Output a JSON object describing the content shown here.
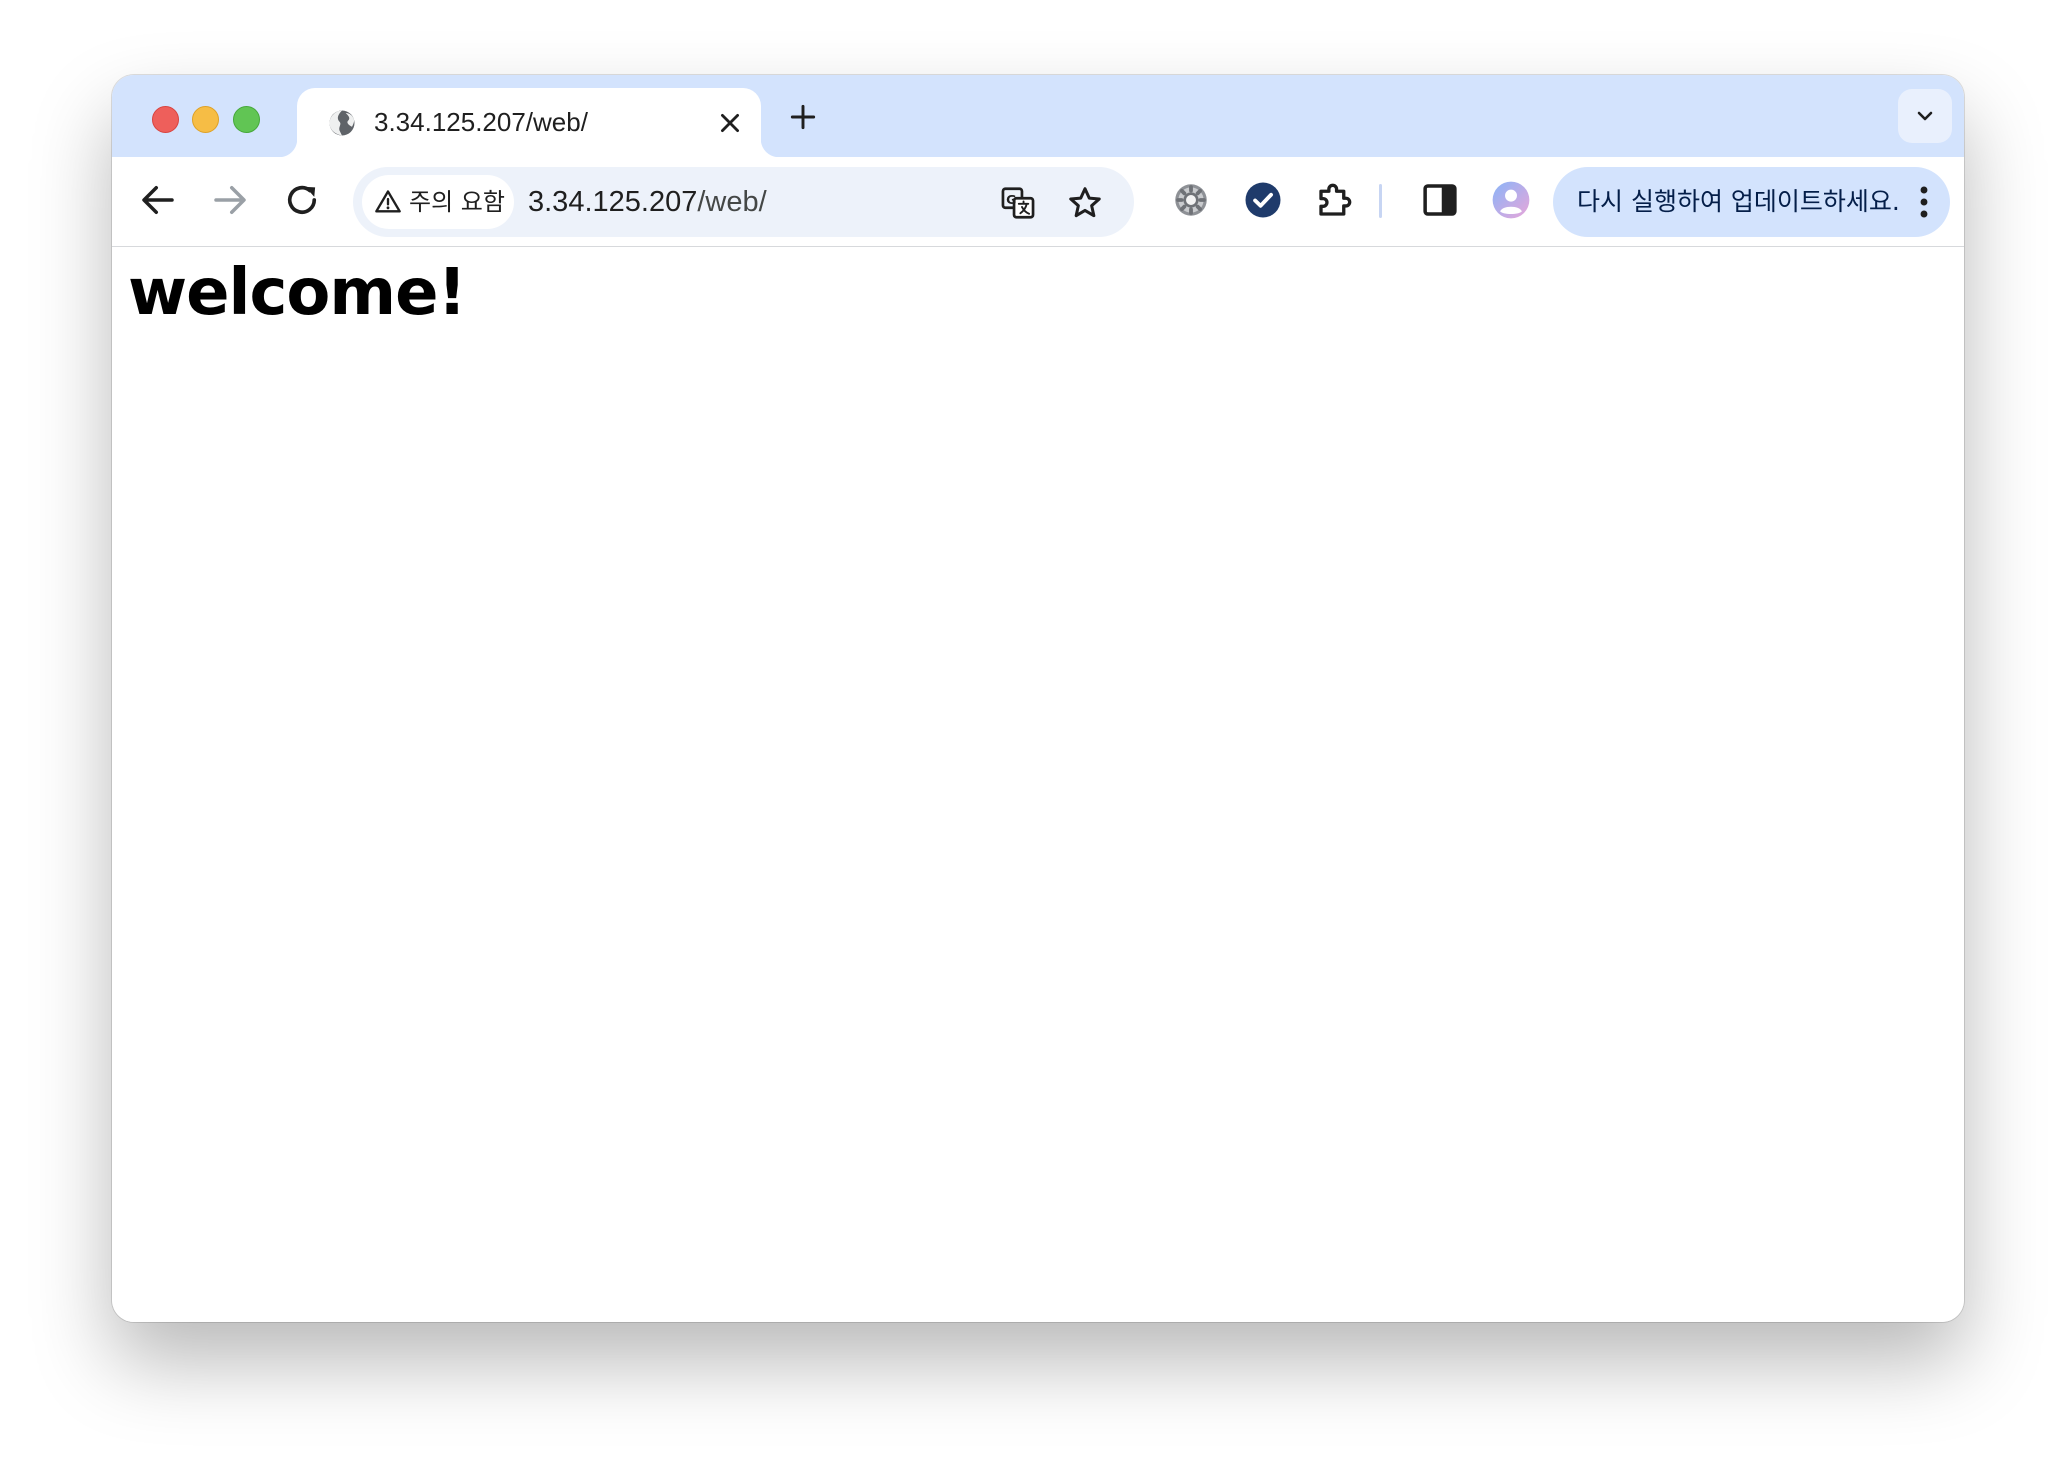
{
  "browser": {
    "tab": {
      "title": "3.34.125.207/web/",
      "icon": "globe-icon"
    },
    "address_bar": {
      "security_chip_label": "주의 요함",
      "url_host": "3.34.125.207",
      "url_path": "/web/"
    },
    "update_button": {
      "label": "다시 실행하여 업데이트하세요."
    },
    "colors": {
      "tabstrip": "#d3e3fd",
      "omnibox": "#edf2fa",
      "update_pill": "#d3e3fd",
      "extension_check": "#1f3b6b"
    }
  },
  "page": {
    "heading": "welcome!"
  }
}
